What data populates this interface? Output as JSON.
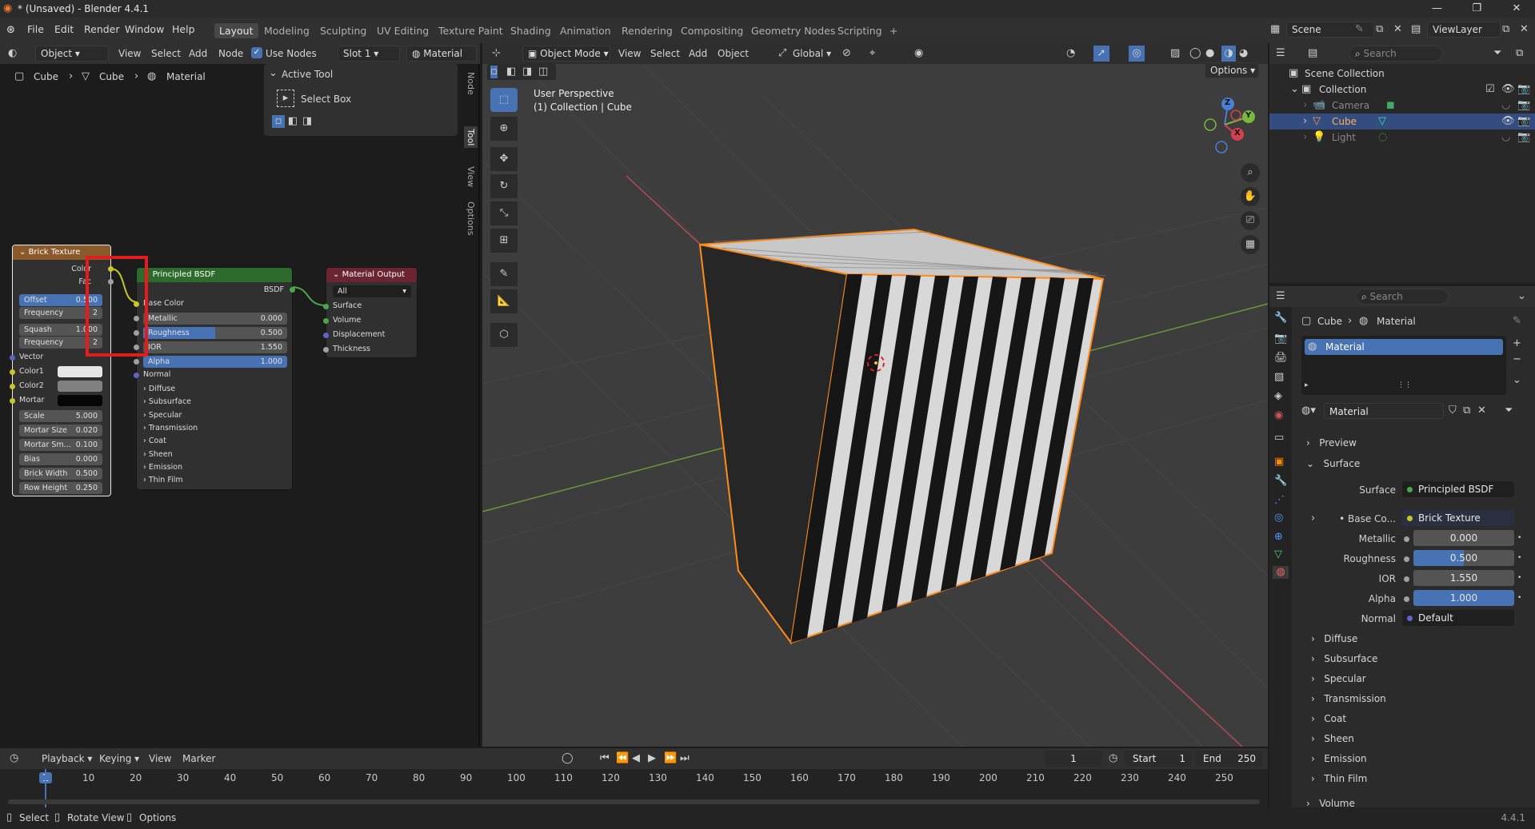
{
  "window": {
    "title": "* (Unsaved) - Blender 4.4.1",
    "controls": [
      "—",
      "❐",
      "✕"
    ]
  },
  "menu": {
    "items": [
      "File",
      "Edit",
      "Render",
      "Window",
      "Help"
    ]
  },
  "workspaces": [
    "Layout",
    "Modeling",
    "Sculpting",
    "UV Editing",
    "Texture Paint",
    "Shading",
    "Animation",
    "Rendering",
    "Compositing",
    "Geometry Nodes",
    "Scripting",
    "+"
  ],
  "topright": {
    "scene": "Scene",
    "viewlayer": "ViewLayer"
  },
  "node_editor": {
    "header": {
      "mode": "Object",
      "view": "View",
      "select": "Select",
      "add": "Add",
      "node": "Node",
      "use_nodes": "Use Nodes",
      "slot": "Slot 1",
      "material": "Material"
    },
    "breadcrumb": [
      "Cube",
      "Cube",
      "Material"
    ],
    "active_tool": {
      "title": "Active Tool",
      "tool": "Select Box"
    },
    "side_tabs": [
      "Node",
      "Tool",
      "View",
      "Options"
    ],
    "brick": {
      "title": "Brick Texture",
      "outputs": [
        "Color",
        "Fac"
      ],
      "offset": {
        "label": "Offset",
        "value": "0.500"
      },
      "freq1": {
        "label": "Frequency",
        "value": "2"
      },
      "squash": {
        "label": "Squash",
        "value": "1.000"
      },
      "freq2": {
        "label": "Frequency",
        "value": "2"
      },
      "inputs": [
        "Vector",
        "Color1",
        "Color2",
        "Mortar"
      ],
      "scale": {
        "label": "Scale",
        "value": "5.000"
      },
      "mortar_size": {
        "label": "Mortar Size",
        "value": "0.020"
      },
      "mortar_smooth": {
        "label": "Mortar Sm...",
        "value": "0.100"
      },
      "bias": {
        "label": "Bias",
        "value": "0.000"
      },
      "brick_width": {
        "label": "Brick Width",
        "value": "0.500"
      },
      "row_height": {
        "label": "Row Height",
        "value": "0.250"
      }
    },
    "bsdf": {
      "title": "Principled BSDF",
      "output": "BSDF",
      "base_color": "Base Color",
      "metallic": {
        "label": "Metallic",
        "value": "0.000"
      },
      "roughness": {
        "label": "Roughness",
        "value": "0.500"
      },
      "ior": {
        "label": "IOR",
        "value": "1.550"
      },
      "alpha": {
        "label": "Alpha",
        "value": "1.000"
      },
      "normal": "Normal",
      "panels": [
        "Diffuse",
        "Subsurface",
        "Specular",
        "Transmission",
        "Coat",
        "Sheen",
        "Emission",
        "Thin Film"
      ]
    },
    "output": {
      "title": "Material Output",
      "target": "All",
      "inputs": [
        "Surface",
        "Volume",
        "Displacement",
        "Thickness"
      ]
    }
  },
  "viewport": {
    "header": {
      "mode": "Object Mode",
      "view": "View",
      "select": "Select",
      "add": "Add",
      "object": "Object",
      "orientation": "Global",
      "options": "Options"
    },
    "overlay": {
      "perspective": "User Perspective",
      "collection": "(1) Collection | Cube"
    },
    "gizmo": {
      "x": "X",
      "y": "Y",
      "z": "Z"
    }
  },
  "outliner": {
    "search_placeholder": "Search",
    "items": [
      {
        "label": "Scene Collection"
      },
      {
        "label": "Collection"
      },
      {
        "label": "Camera"
      },
      {
        "label": "Cube"
      },
      {
        "label": "Light"
      }
    ]
  },
  "properties": {
    "search_placeholder": "Search",
    "breadcrumb": [
      "Cube",
      "Material"
    ],
    "slot": "Material",
    "material_name": "Material",
    "sections": {
      "preview": "Preview",
      "surface": "Surface"
    },
    "surface": {
      "label": "Surface",
      "value": "Principled BSDF"
    },
    "base_color": {
      "label": "Base Co...",
      "value": "Brick Texture"
    },
    "metallic": {
      "label": "Metallic",
      "value": "0.000"
    },
    "roughness": {
      "label": "Roughness",
      "value": "0.500",
      "fill": 0.5
    },
    "ior": {
      "label": "IOR",
      "value": "1.550"
    },
    "alpha": {
      "label": "Alpha",
      "value": "1.000",
      "fill": 1.0
    },
    "normal": {
      "label": "Normal",
      "value": "Default"
    },
    "panels": [
      "Diffuse",
      "Subsurface",
      "Specular",
      "Transmission",
      "Coat",
      "Sheen",
      "Emission",
      "Thin Film",
      "Volume"
    ]
  },
  "timeline": {
    "playback": "Playback",
    "keying": "Keying",
    "view": "View",
    "marker": "Marker",
    "current_frame": "1",
    "start_label": "Start",
    "start": "1",
    "end_label": "End",
    "end": "250",
    "ticks": [
      "1",
      "10",
      "20",
      "30",
      "40",
      "50",
      "60",
      "70",
      "80",
      "90",
      "100",
      "110",
      "120",
      "130",
      "140",
      "150",
      "160",
      "170",
      "180",
      "190",
      "200",
      "210",
      "220",
      "230",
      "240",
      "250"
    ]
  },
  "status": {
    "select": "Select",
    "rotate": "Rotate View",
    "options": "Options",
    "version": "4.4.1"
  },
  "colors": {
    "accent": "#4772b3",
    "brick_header": "#8a5a2b",
    "bsdf_header": "#2c6b2c",
    "output_header": "#6b2430",
    "selection": "#ff8c1a",
    "highlight_box": "#e31c1c"
  }
}
